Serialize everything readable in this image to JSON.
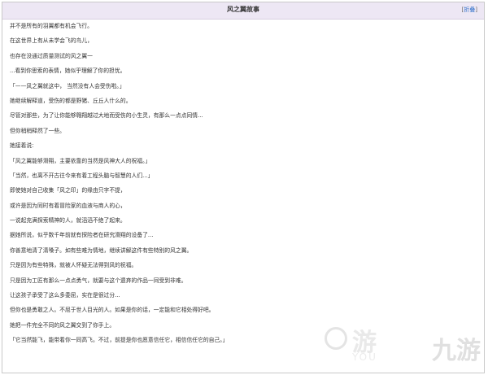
{
  "panel": {
    "title": "风之翼故事",
    "collapse_open": "[",
    "collapse_label": "折叠",
    "collapse_close": "]"
  },
  "story": {
    "lines": [
      "并不是所有的羽翼都有机会飞行。",
      "在这世界上有从未学会飞的鸟儿，",
      "也存在没通过质量测试的风之翼一",
      "...看到你思索的表情，她似乎理解了你的担忧。",
      "「——风之翼就这中， 当然没有人会受伤啦。」",
      "她继续解释道，受伤的都是野猪、丘丘人什么的。",
      "尽管对那些，为了让你能够翱翔越过大地而受伤的小生灵，有那么一点点同情...",
      "但你稍稍释然了一些。",
      "她接着说:",
      "「风之翼能够滑翔，主要依靠的当然是风神大人的祝福。」",
      "「当然，也离不开古往今来有着工程头脑与智慧的人们...」",
      "即使她对自己收集「风之印」的缘由只字不提，",
      "或许是因为同时有着冒险家的血液与商人的心，",
      "一说起充满探索精神的人，就滔滔不绝了起来。",
      "据她所说，似乎数千年前就有探险者在研究滑翔的设备了...",
      "你善意地清了清嗓子。如有些难为情地，继续讲解这件有些特别的风之翼。",
      "只是因为有些特殊，就被人怀疑无法得到风的祝福。",
      "只是因为工匠有那么一点点勇气，就要与这个遗弃的作品一同受到非难。",
      "让这孩子承受了这么多委屈，实在是很过分...",
      "但你也是勇敢之人。不屈于世人目光的人。如果是你的话，一定能和它相处得好吧。",
      "她把一件完全不同的风之翼交到了你手上。",
      "「它当然能飞，能带着你一同高飞。不过，前提是你也愿意信任它，相信信任它的自己。」"
    ]
  },
  "watermark": {
    "main_text": "游",
    "sub_text": "YOU",
    "logo_text": "九游"
  }
}
